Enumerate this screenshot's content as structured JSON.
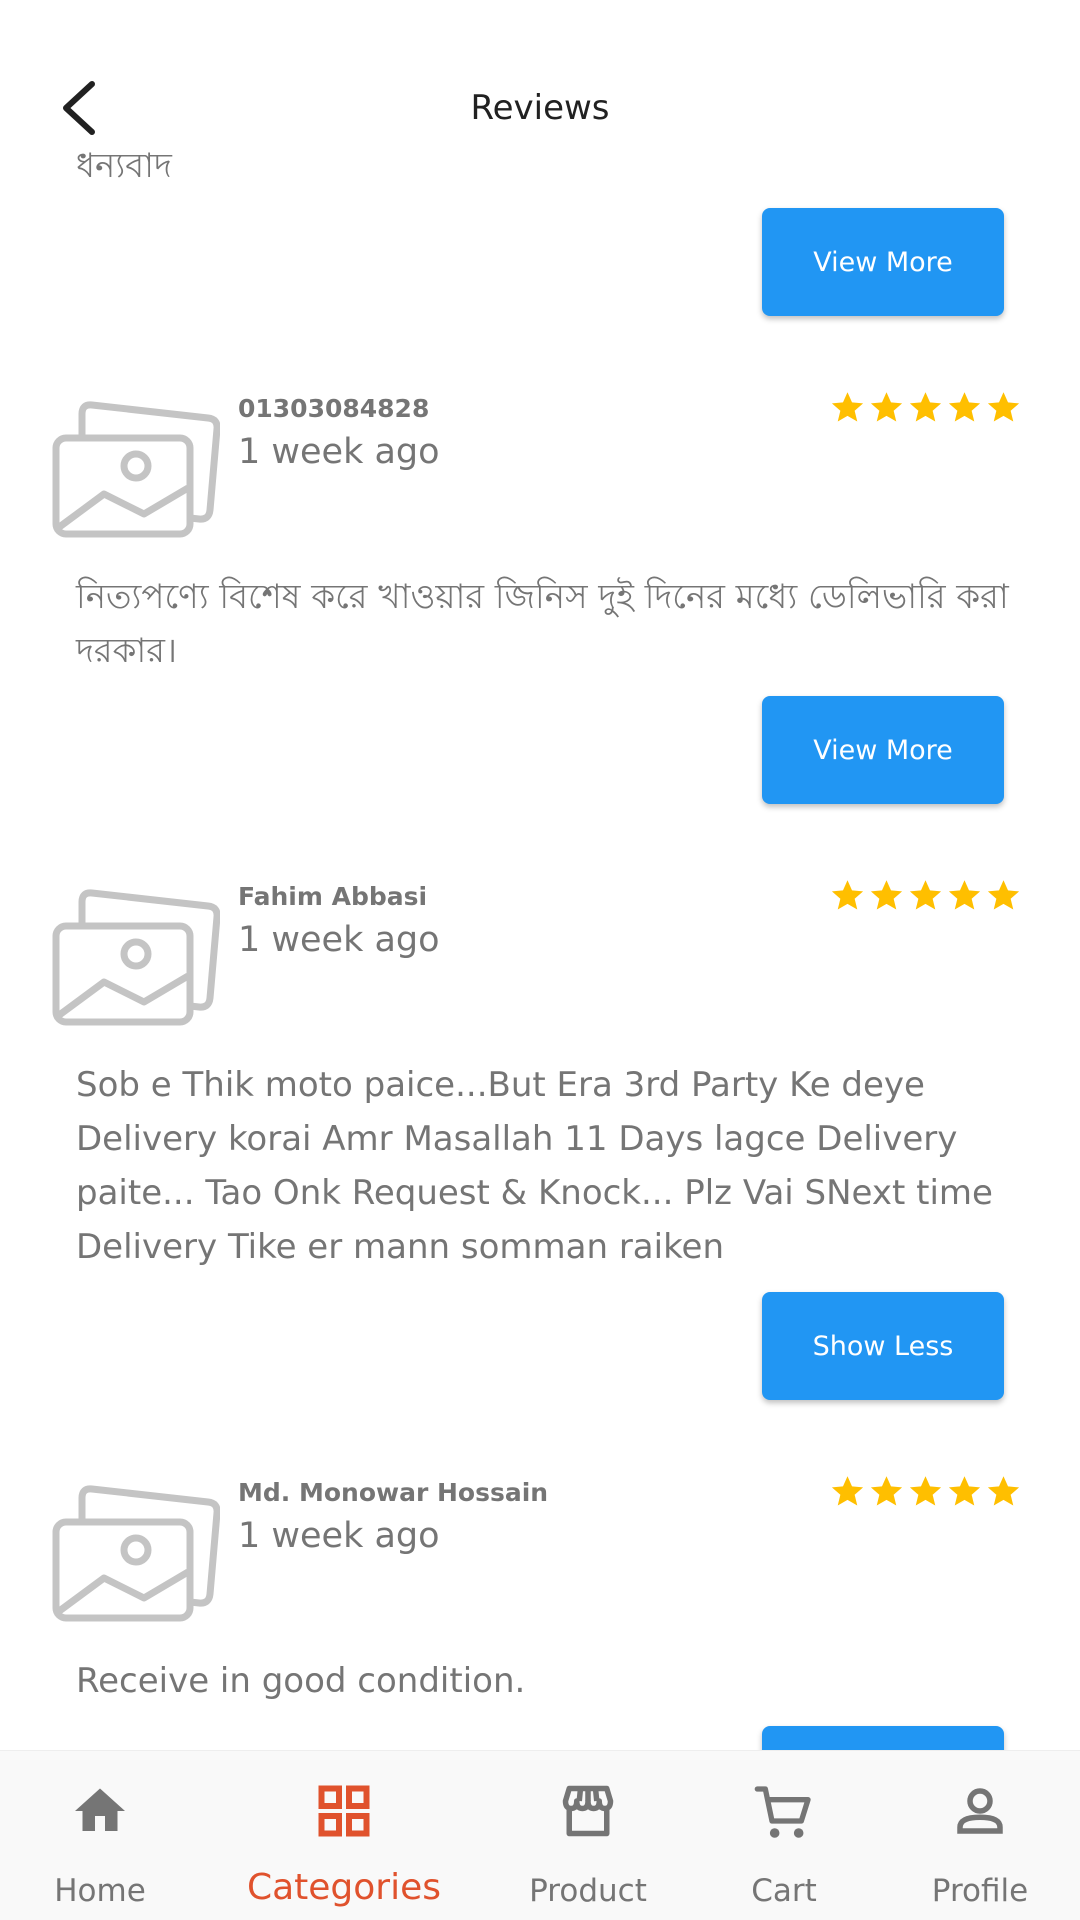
{
  "header": {
    "title": "Reviews"
  },
  "top_partial": {
    "text": "ধন্যবাদ",
    "button_label": "View More"
  },
  "reviews": [
    {
      "reviewer": "01303084828",
      "time": "1 week ago",
      "rating": 5,
      "text": "নিত্যপণ্যে বিশেষ করে খাওয়ার জিনিস দুই দিনের মধ্যে ডেলিভারি করা দরকার।",
      "button_label": "View More"
    },
    {
      "reviewer": "Fahim Abbasi",
      "time": "1 week ago",
      "rating": 5,
      "text": "Sob e Thik moto paice...But Era 3rd Party Ke deye Delivery korai Amr Masallah 11 Days lagce Delivery paite... Tao Onk Request & Knock... Plz Vai SNext time Delivery Tike er mann somman raiken",
      "button_label": "Show Less"
    },
    {
      "reviewer": "Md. Monowar Hossain",
      "time": "1 week ago",
      "rating": 5,
      "text": "Receive in good condition."
    }
  ],
  "bottom_nav": {
    "items": [
      {
        "label": "Home",
        "icon": "home-icon"
      },
      {
        "label": "Categories",
        "icon": "grid-icon",
        "active": true
      },
      {
        "label": "Product",
        "icon": "store-icon"
      },
      {
        "label": "Cart",
        "icon": "cart-icon"
      },
      {
        "label": "Profile",
        "icon": "person-icon"
      }
    ]
  },
  "colors": {
    "primary_button": "#2196f3",
    "star": "#ffbf00",
    "active_nav": "#e0522d",
    "muted_text": "#757575"
  }
}
